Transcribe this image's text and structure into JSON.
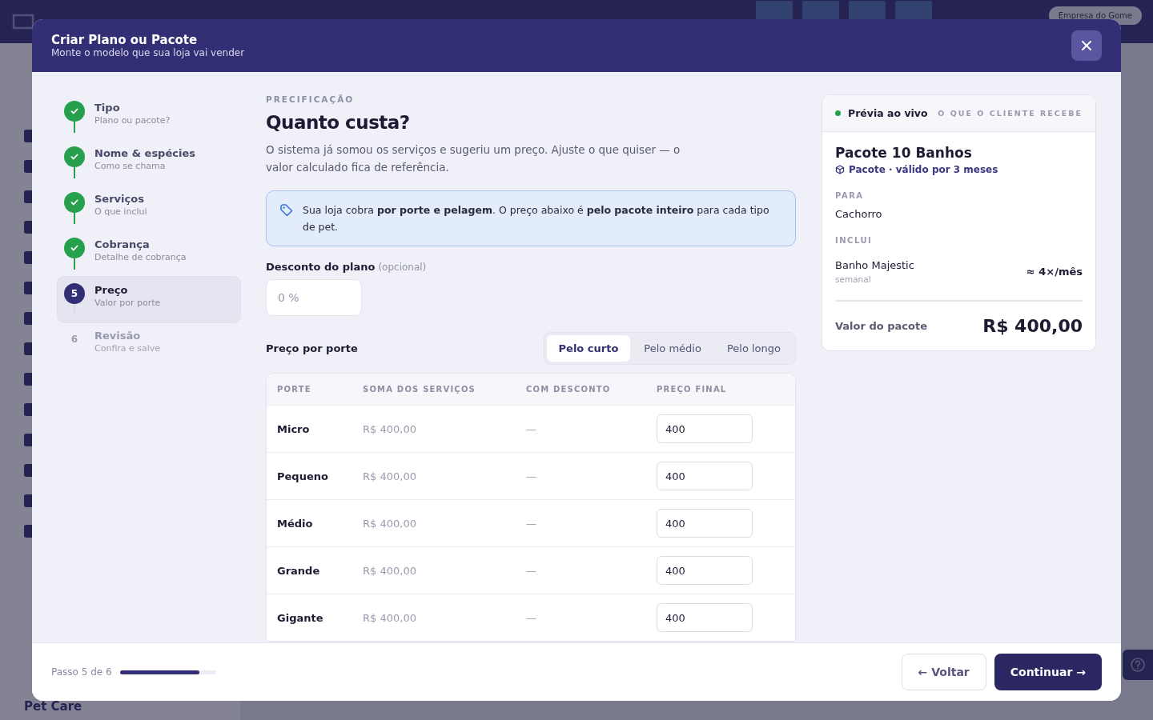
{
  "background": {
    "company": "Empresa do Gome",
    "sidebar_footer": "Pet Care"
  },
  "modal": {
    "title": "Criar Plano ou Pacote",
    "subtitle": "Monte o modelo que sua loja vai vender"
  },
  "steps": [
    {
      "title": "Tipo",
      "subtitle": "Plano ou pacote?",
      "completed": true,
      "selected": false
    },
    {
      "title": "Nome & espécies",
      "subtitle": "Como se chama",
      "completed": true,
      "selected": false
    },
    {
      "title": "Serviços",
      "subtitle": "O que inclui",
      "completed": true,
      "selected": false
    },
    {
      "title": "Cobrança",
      "subtitle": "Detalhe de cobrança",
      "completed": true,
      "selected": false
    },
    {
      "number": "5",
      "title": "Preço",
      "subtitle": "Valor por porte",
      "completed": false,
      "selected": true
    },
    {
      "number": "6",
      "title": "Revisão",
      "subtitle": "Confira e salve",
      "completed": false,
      "selected": false
    }
  ],
  "content": {
    "eyebrow": "PRECIFICAÇÃO",
    "heading": "Quanto custa?",
    "description": "O sistema já somou os serviços e sugeriu um preço. Ajuste o que quiser — o valor calculado fica de referência.",
    "notice": "Sua loja cobra **por porte e pelagem**. O preço abaixo é **pelo pacote inteiro** para cada tipo de pet.",
    "discount": {
      "label": "Desconto do plano",
      "hint": "(opcional)",
      "placeholder": "0 %"
    },
    "price_label": "Preço por porte",
    "tabs": [
      {
        "label": "Pelo curto",
        "selected": true
      },
      {
        "label": "Pelo médio",
        "selected": false
      },
      {
        "label": "Pelo longo",
        "selected": false
      }
    ],
    "table": {
      "columns": [
        "PORTE",
        "SOMA DOS SERVIÇOS",
        "COM DESCONTO",
        "PREÇO FINAL"
      ],
      "rows": [
        {
          "porte": "Micro",
          "soma": "R$ 400,00",
          "desconto": "—",
          "preco": "400"
        },
        {
          "porte": "Pequeno",
          "soma": "R$ 400,00",
          "desconto": "—",
          "preco": "400"
        },
        {
          "porte": "Médio",
          "soma": "R$ 400,00",
          "desconto": "—",
          "preco": "400"
        },
        {
          "porte": "Grande",
          "soma": "R$ 400,00",
          "desconto": "—",
          "preco": "400"
        },
        {
          "porte": "Gigante",
          "soma": "R$ 400,00",
          "desconto": "—",
          "preco": "400"
        }
      ]
    }
  },
  "preview": {
    "live": {
      "label": "Prévia ao vivo",
      "color": "#22a04b"
    },
    "caption": "O QUE O CLIENTE RECEBE",
    "title": "Pacote 10 Banhos",
    "subtitle": "Pacote · válido por 3 meses",
    "for_label": "PARA",
    "for_value": "Cachorro",
    "includes_label": "INCLUI",
    "services": [
      {
        "name": "Banho Majestic",
        "frequency": "semanal",
        "amount": "≈ 4×/mês"
      }
    ],
    "total_label": "Valor do pacote",
    "total_value": "R$ 400,00"
  },
  "footer": {
    "step_text": "Passo 5 de 6",
    "progress": {
      "level": 0.83
    },
    "back": "← Voltar",
    "next": "Continuar →"
  }
}
